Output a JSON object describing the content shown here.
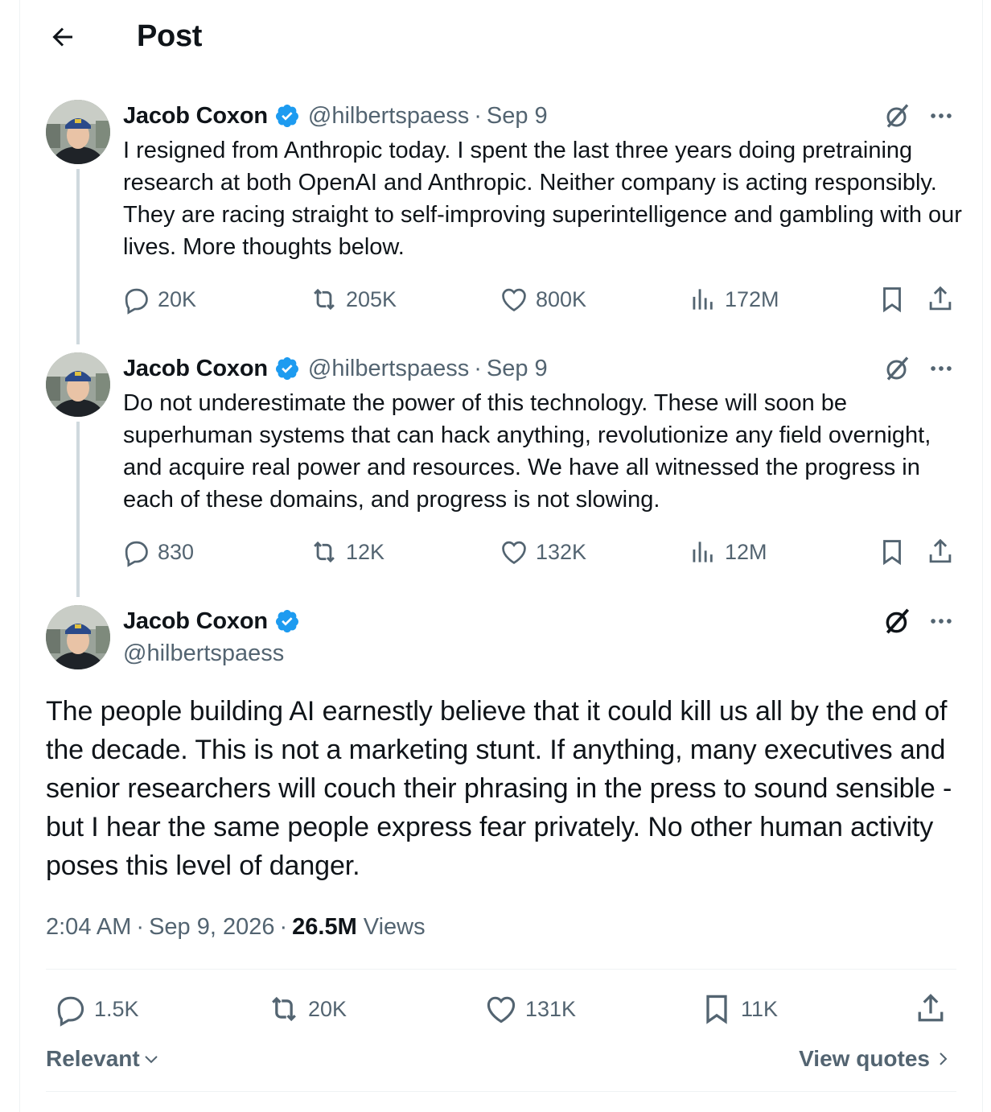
{
  "header": {
    "title": "Post"
  },
  "thread": [
    {
      "author": "Jacob Coxon",
      "handle": "@hilbertspaess",
      "date": "Sep 9",
      "text": "I resigned from Anthropic today. I spent the last three years doing pretraining research at both OpenAI and Anthropic. Neither company is acting responsibly. They are racing straight to self-improving superintelligence and gambling with our lives. More thoughts below.",
      "replies": "20K",
      "reposts": "205K",
      "likes": "800K",
      "views": "172M"
    },
    {
      "author": "Jacob Coxon",
      "handle": "@hilbertspaess",
      "date": "Sep 9",
      "text": "Do not underestimate the power of this technology. These will soon be superhuman systems that can hack anything, revolutionize any field overnight, and acquire real power and resources. We have all witnessed the progress in each of these domains, and progress is not slowing.",
      "replies": "830",
      "reposts": "12K",
      "likes": "132K",
      "views": "12M"
    }
  ],
  "main_post": {
    "author": "Jacob Coxon",
    "handle": "@hilbertspaess",
    "text": "The people building AI earnestly believe that it could kill us all by the end of the decade. This is not a marketing stunt. If anything, many executives and senior researchers will couch their phrasing in the press to sound sensible - but I hear the same people express fear privately. No other human activity poses this level of danger.",
    "time": "2:04 AM",
    "full_date": "Sep 9, 2026",
    "views_count": "26.5M",
    "views_label": "Views",
    "replies": "1.5K",
    "reposts": "20K",
    "likes": "131K",
    "bookmarks": "11K"
  },
  "footer": {
    "sort_label": "Relevant",
    "quotes_label": "View quotes"
  },
  "colors": {
    "text": "#0f1419",
    "secondary": "#536471",
    "verified": "#1d9bf0",
    "thread_line": "#cfd9de"
  },
  "icons": [
    "back-arrow-icon",
    "verified-badge-icon",
    "grok-icon",
    "more-icon",
    "reply-icon",
    "repost-icon",
    "like-icon",
    "views-icon",
    "bookmark-icon",
    "share-icon",
    "chevron-down-icon",
    "chevron-right-icon"
  ]
}
